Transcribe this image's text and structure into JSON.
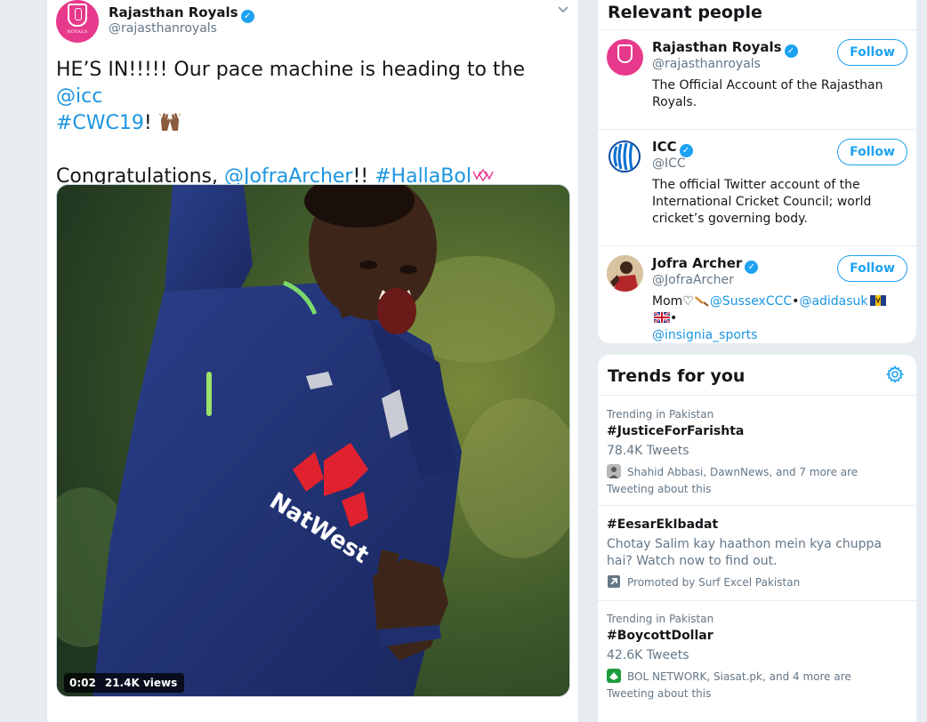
{
  "tweet": {
    "author_name": "Rajasthan Royals",
    "author_handle": "@rajasthanroyals",
    "avatar_text": "ROYALS",
    "line1_text": "HE’S IN!!!!! Our pace machine is heading to the ",
    "line1_mention": "@icc",
    "line2_hashtag": "#CWC19",
    "line2_after": "! ",
    "line3_before": "Congratulations, ",
    "line3_mention": "@JofraArcher",
    "line3_middle": "!! ",
    "line3_hashtag": "#HallaBol",
    "video_time": "0:02",
    "video_views": "21.4K views"
  },
  "relevant_people": {
    "title": "Relevant people",
    "people": [
      {
        "name": "Rajasthan Royals",
        "handle": "@rajasthanroyals",
        "follow_label": "Follow",
        "bio": "The Official Account of the Rajasthan Royals."
      },
      {
        "name": "ICC",
        "handle": "@ICC",
        "follow_label": "Follow",
        "bio": "The official Twitter account of the International Cricket Council; world cricket’s governing body."
      },
      {
        "name": "Jofra Archer",
        "handle": "@JofraArcher",
        "follow_label": "Follow",
        "bio_prefix": "Mom♡",
        "bio_link1": "@SussexCCC",
        "bio_sep1": "•",
        "bio_link2": "@adidasuk",
        "bio_sep2": "•",
        "bio_link3": "@insignia_sports"
      }
    ]
  },
  "trends": {
    "title": "Trends for you",
    "items": [
      {
        "meta": "Trending in Pakistan",
        "name": "#JusticeForFarishta",
        "count": "78.4K Tweets",
        "context": "Shahid Abbasi, DawnNews, and 7 more are Tweeting about this"
      },
      {
        "name": "#EesarEkIbadat",
        "description": "Chotay Salim kay haathon mein kya chuppa hai? Watch now to find out.",
        "promoted": "Promoted by Surf Excel Pakistan"
      },
      {
        "meta": "Trending in Pakistan",
        "name": "#BoycottDollar",
        "count": "42.6K Tweets",
        "context": "BOL NETWORK, Siasat.pk, and 4 more are Tweeting about this"
      }
    ]
  },
  "colors": {
    "accent": "#1da1f2",
    "link": "#1b95e0",
    "royals_pink": "#e7398b"
  }
}
